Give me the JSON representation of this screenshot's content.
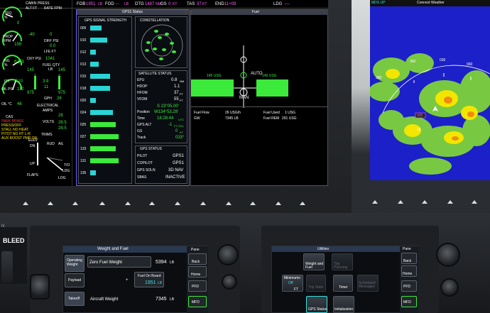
{
  "top_bar": {
    "fob_label": "FOB",
    "fob_value": "1951",
    "fob_unit": "LB",
    "fod_label": "FOD",
    "fod_value": "---",
    "fod_unit": "LB",
    "dtg_label": "DTG",
    "dtg_value": "1487",
    "dtg_unit": "NM",
    "gs_label": "GS",
    "gs_value": "0",
    "gs_unit": "KT",
    "tas_label": "TAS",
    "tas_value": "37",
    "tas_unit": "KT",
    "end_label": "END",
    "end_value": "11+09",
    "ldg_label": "LDG",
    "ldg_value": "----"
  },
  "eis": {
    "cabin_press": "CABIN PRESS",
    "alt_ft": "ALT FT",
    "rate_fpm": "RATE FPM",
    "alt_val": "-40",
    "rate_val": "0",
    "diff_psi": "DIFF PSI",
    "diff_val": "0.0",
    "trq_label": "TRQ",
    "trq_unit": "%",
    "trq_val": "0",
    "prop_label": "PROP",
    "prop_unit": "RPM",
    "prop_val": "199",
    "ng_label": "NG",
    "ng_unit": "%",
    "ng_val": "61.3",
    "itt_label": "ITT",
    "itt_val": "510",
    "lfe_label": "LFE FT",
    "oil_label": "OIL PSI",
    "oil_val": "112",
    "oilc_label": "OIL °C",
    "oilc_val": "46",
    "oxy_label": "OXY PSI",
    "oxy_val": "1041",
    "fuel_qty": "FUEL QTY",
    "fuel_unit": "LB",
    "fuel_l": "145",
    "fuel_r": "145",
    "fuel_lb_l": "975",
    "fuel_lb_r": "975",
    "fuel_flow": "3.9",
    "fuel_temp": "11",
    "gph_label": "GPH",
    "gph_val": "26",
    "elec_label": "ELECTRICAL",
    "amps_label": "AMPS",
    "amps_val": "28",
    "volts_label": "VOLTS",
    "volts_val": "28.5",
    "volts_val2": "28.5",
    "cas_label": "CAS",
    "cas_msgs": [
      "PARK BRAKE",
      "PRESS/OFF",
      "STALL NO HEAT",
      "PITOT NO HT L-R",
      "AUX BOOST PMP ON"
    ],
    "trims_label": "TRIMS",
    "elev_label": "ELEV",
    "dn": "DN",
    "up": "UP",
    "flaps_label": "FLAPS",
    "log_label": "LOG",
    "rud_label": "RUD",
    "ail_label": "AIL",
    "to": "T/O",
    "ldg": "LDG"
  },
  "gps_panel": {
    "header": "GPS1 Status",
    "signal_title": "GPS SIGNAL STRENGTH",
    "prns": [
      "005",
      "010",
      "012",
      "013",
      "015",
      "018",
      "020",
      "024",
      "025",
      "027",
      "133",
      "131",
      "135"
    ],
    "constellation_title": "CONSTELLATION",
    "sat_status_title": "SATELLITE STATUS",
    "epu_l": "EPU",
    "epu_v": "0.8",
    "epu_u": "NM",
    "hdop_l": "HDOP",
    "hdop_v": "1.1",
    "hfom_l": "HFOM",
    "hfom_v": "37",
    "hfom_u": "FT",
    "vfom_l": "VFOM",
    "vfom_v": "55",
    "vfom_u": "FT",
    "lat": "S 23°05.00'",
    "pos_l": "Position",
    "lon": "W134°53.28'",
    "time_l": "Time",
    "time_v": "18:28:44",
    "time_u": "UTC",
    "gpsalt_l": "GPS ALT",
    "gpsalt_v": "-1",
    "gpsalt_u": "FT GSL",
    "gs_l": "GS",
    "gs_v": "0",
    "gs_u": "KT",
    "trk_l": "Track",
    "trk_v": "033°",
    "gps_status_title": "GPS STATUS",
    "pilot_l": "PILOT",
    "pilot_v": "GPS1",
    "copilot_l": "COPILOT",
    "copilot_v": "GPS1",
    "soln_l": "GPS SOLN",
    "soln_v": "3D NAV",
    "sbas_l": "SBAS",
    "sbas_v": "INACTIVE"
  },
  "fuel_panel": {
    "header": "Fuel",
    "left_qty": "145 USG",
    "right_qty": "145 USG",
    "auto": "AUTO",
    "man": "MAN",
    "flow_l": "Fuel Flow",
    "flow_v": "26 USG/h",
    "used_l": "Fuel Used",
    "used_v": "1 USG",
    "gw_l": "GW",
    "gw_v": "7345 LB",
    "rem_l": "Fuel REM",
    "rem_v": "291 USG"
  },
  "weather": {
    "header": "Connext Weather",
    "tag": "MDS UP",
    "ticks": [
      "360",
      "030",
      "060",
      "090"
    ],
    "brg": "020",
    "dist": "10"
  },
  "bleed": {
    "label": "BLEED",
    "side": "N"
  },
  "gtc_left": {
    "title": "Weight and Fuel",
    "tabs": [
      "Operating Weight",
      "Payload",
      "Takeoff"
    ],
    "zfw_l": "Zero Fuel Weight",
    "zfw_v": "5394",
    "zfw_u": "LB",
    "fob_l": "Fuel On Board",
    "fob_v": "1951",
    "fob_u": "LB",
    "aw_l": "Aircraft Weight",
    "aw_v": "7345",
    "aw_u": "LB",
    "plus": "+",
    "panel_l": "Pane",
    "back": "Back",
    "home": "Home",
    "pfd": "PFD",
    "mfd": "MFD"
  },
  "gtc_right": {
    "title": "Utilities",
    "tiles": [
      "Weight and Fuel",
      "Trip Planning",
      "Minimums",
      "Trip Stats",
      "Timer",
      "Scheduled Messages",
      "GPS Status",
      "Initialization"
    ],
    "min_off": "Off",
    "min_ft": "FT",
    "panel_l": "Pane",
    "back": "Back",
    "home": "Home",
    "pfd": "PFD",
    "mfd": "MFD"
  }
}
